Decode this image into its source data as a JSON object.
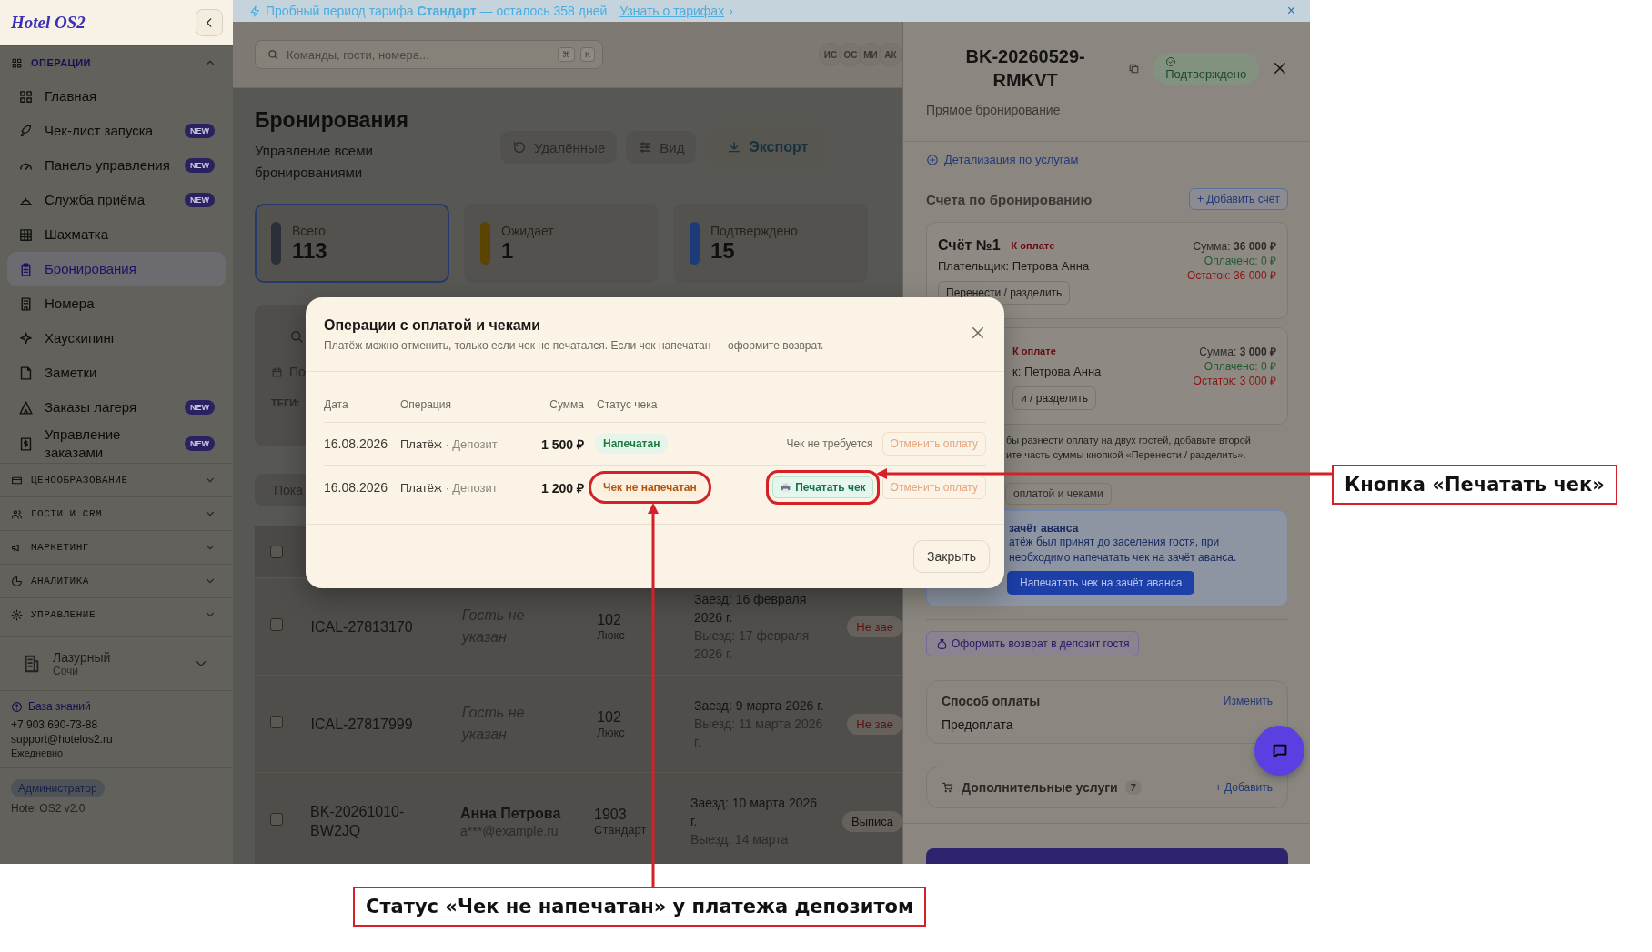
{
  "banner": {
    "text": "Пробный период тарифа **Стандарт** — осталось 358 дней.",
    "link": "Узнать о тарифах",
    "link_arrow": "›",
    "close": "×"
  },
  "sidebar": {
    "logo": "Hotel OS2",
    "sections": [
      {
        "title": "ОПЕРАЦИИ",
        "expanded": true,
        "items": [
          {
            "label": "Главная",
            "selected": false
          },
          {
            "label": "Чек-лист запуска",
            "badge": "NEW",
            "selected": false
          },
          {
            "label": "Панель управления",
            "badge": "NEW",
            "selected": false
          },
          {
            "label": "Служба приёма",
            "badge": "NEW",
            "selected": false
          },
          {
            "label": "Шахматка",
            "selected": false
          },
          {
            "label": "Бронирования",
            "selected": true
          },
          {
            "label": "Номера",
            "selected": false
          },
          {
            "label": "Хаускипинг",
            "selected": false
          },
          {
            "label": "Заметки",
            "selected": false
          },
          {
            "label": "Заказы лагеря",
            "badge": "NEW",
            "selected": false
          },
          {
            "label": "Управление заказами",
            "badge": "NEW",
            "selected": false
          }
        ]
      },
      {
        "title": "ЦЕНООБРАЗОВАНИЕ",
        "expanded": false
      },
      {
        "title": "ГОСТИ И CRM",
        "expanded": false
      },
      {
        "title": "МАРКЕТИНГ",
        "expanded": false
      },
      {
        "title": "АНАЛИТИКА",
        "expanded": false
      },
      {
        "title": "УПРАВЛЕНИЕ",
        "expanded": false
      }
    ],
    "hotel": {
      "name": "Лазурный",
      "city": "Сочи"
    },
    "help": {
      "link": "База знаний",
      "phone": "+7 903 690-73-88",
      "email": "support@hotelos2.ru",
      "hours": "Ежедневно"
    },
    "role": "Администратор",
    "version": "Hotel OS2 v2.0"
  },
  "header": {
    "search_placeholder": "Команды, гости, номера...",
    "shortcut": [
      "⌘",
      "K"
    ],
    "avatars": [
      "ИС",
      "ОС",
      "МИ",
      "АК"
    ]
  },
  "page": {
    "title": "Бронирования",
    "subtitle": "Управление всеми бронированиями",
    "actions": [
      {
        "label": "Удалённые",
        "kind": "restore"
      },
      {
        "label": "Вид",
        "kind": "view"
      },
      {
        "label": "Экспорт",
        "kind": "export"
      }
    ],
    "stats": [
      {
        "label": "Всего",
        "value": "113",
        "color": "#2b2f38",
        "selected": true
      },
      {
        "label": "Ожидает",
        "value": "1",
        "color": "#5a4400",
        "selected": false
      },
      {
        "label": "Подтверждено",
        "value": "15",
        "color": "#1d3b7a",
        "selected": false
      }
    ],
    "filters": {
      "date_label": "По",
      "tags_label": "ТЕГИ:"
    },
    "pagination_label": "Пока"
  },
  "table": {
    "all_checked": false,
    "rows": [
      {
        "id": "ICAL-27813170",
        "guest": "Гость не указан",
        "room": "102",
        "room_type": "Люкс",
        "checkin": "Заезд: 16 февраля 2026 г.",
        "checkout": "Выезд: 17 февраля 2026 г.",
        "status": "Не зае",
        "color": "#5a1212",
        "checked": false
      },
      {
        "id": "ICAL-27817999",
        "guest": "Гость не указан",
        "room": "102",
        "room_type": "Люкс",
        "checkin": "Заезд: 9 марта 2026 г.",
        "checkout": "Выезд: 11 марта 2026 г.",
        "status": "Не зае",
        "color": "#5a1212",
        "checked": false
      },
      {
        "id": "BK-20261010-BW2JQ",
        "guest": "Анна Петрова",
        "email": "a***@example.ru",
        "room": "1903",
        "room_type": "Стандарт",
        "checkin": "Заезд: 10 марта 2026 г.",
        "checkout": "Выезд: 14 марта",
        "status": "Выписа",
        "color": "#111111",
        "checked": false
      }
    ]
  },
  "drawer": {
    "code": "BK-20260529-RMKVT",
    "status": "Подтверждено",
    "source": "Прямое бронирование",
    "services_link": "Детализация по услугам",
    "invoices_title": "Счета по бронированию",
    "add_invoice": "+ Добавить счёт",
    "invoices": [
      {
        "title": "Счёт №1",
        "state": "К оплате",
        "payer": "Плательщик: Петрова Анна",
        "sum_label": "Сумма:",
        "sum": "36 000 ₽",
        "paid": "Оплачено: 0 ₽",
        "rest": "Остаток: 36 000 ₽",
        "action": "Перенести / разделить"
      },
      {
        "state": "К оплате",
        "payer": "к: Петрова Анна",
        "sum_label": "Сумма:",
        "sum": "3 000 ₽",
        "paid": "Оплачено: 0 ₽",
        "rest": "Остаток: 3 000 ₽",
        "action": "и / разделить"
      }
    ],
    "note_lines": [
      "бы разнести оплату на двух гостей, добавьте второй",
      "ите часть суммы кнопкой «Перенести / разделить»."
    ],
    "ops_button": "оплатой и чеками",
    "advance": {
      "title": "зачёт аванса",
      "lines": [
        "атёж был принят до заселения гостя, при",
        "необходимо напечатать чек на зачёт аванса."
      ],
      "button": "Напечатать чек на зачёт аванса"
    },
    "refund_button": "Оформить возврат в депозит гостя",
    "payment": {
      "title": "Способ оплаты",
      "change": "Изменить",
      "value": "Предоплата"
    },
    "extras": {
      "title": "Дополнительные услуги",
      "count": "7",
      "add": "+ Добавить"
    }
  },
  "modal": {
    "title": "Операции с оплатой и чеками",
    "subtitle": "Платёж можно отменить, только если чек не печатался. Если чек напечатан — оформите возврат.",
    "columns": [
      "Дата",
      "Операция",
      "Сумма",
      "Статус чека"
    ],
    "rows": [
      {
        "date": "16.08.2026",
        "operation": "Платёж",
        "separator": "·",
        "method": "Депозит",
        "amount": "1 500 ₽",
        "receipt": "Напечатан",
        "printed": true,
        "note": "Чек не требуется",
        "cancel": "Отменить оплату",
        "highlighted": false
      },
      {
        "date": "16.08.2026",
        "operation": "Платёж",
        "separator": "·",
        "method": "Депозит",
        "amount": "1 200 ₽",
        "receipt": "Чек не напечатан",
        "printed": false,
        "print_button": "Печатать чек",
        "cancel": "Отменить оплату",
        "highlighted": true
      }
    ],
    "close_button": "Закрыть"
  },
  "annotations": [
    {
      "text": "Кнопка «Печатать чек»"
    },
    {
      "text": "Статус «Чек не напечатан» у платежа депозитом"
    }
  ]
}
